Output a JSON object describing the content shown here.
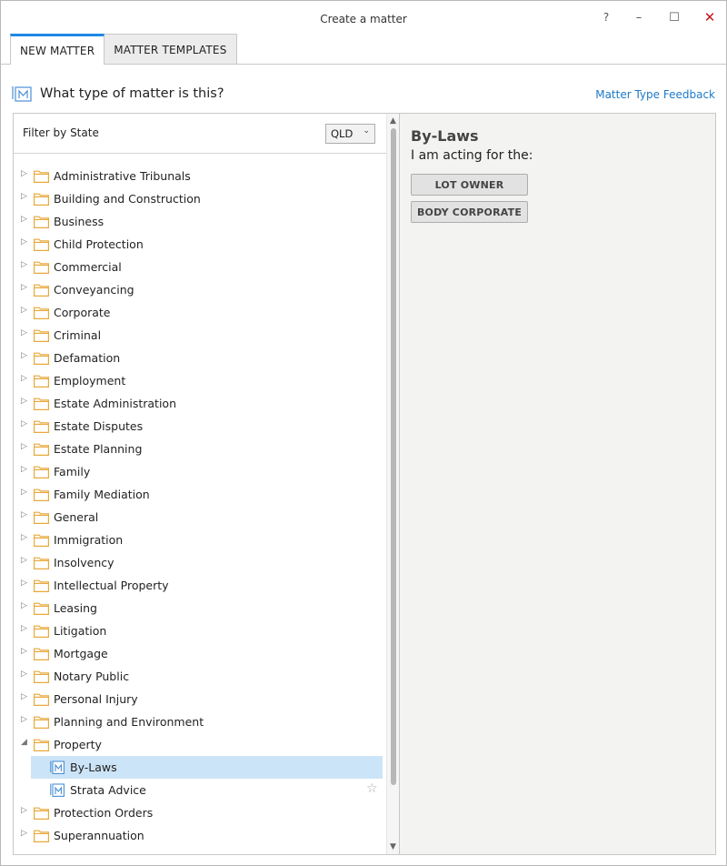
{
  "window": {
    "title": "Create a matter",
    "help_label": "?",
    "min_label": "–",
    "max_label": "☐",
    "close_label": "✕"
  },
  "tabs": [
    {
      "label": "NEW MATTER",
      "active": true
    },
    {
      "label": "MATTER TEMPLATES",
      "active": false
    }
  ],
  "header": {
    "question": "What type of matter is this?",
    "feedback_link": "Matter Type Feedback",
    "icon": "matter-type-icon"
  },
  "filter": {
    "label": "Filter by State",
    "state_value": "QLD",
    "chevron": "⌄"
  },
  "tree": {
    "items": [
      {
        "label": "Administrative Tribunals"
      },
      {
        "label": "Building and Construction"
      },
      {
        "label": "Business"
      },
      {
        "label": "Child Protection"
      },
      {
        "label": "Commercial"
      },
      {
        "label": "Conveyancing"
      },
      {
        "label": "Corporate"
      },
      {
        "label": "Criminal"
      },
      {
        "label": "Defamation"
      },
      {
        "label": "Employment"
      },
      {
        "label": "Estate Administration"
      },
      {
        "label": "Estate Disputes"
      },
      {
        "label": "Estate Planning"
      },
      {
        "label": "Family"
      },
      {
        "label": "Family Mediation"
      },
      {
        "label": "General"
      },
      {
        "label": "Immigration"
      },
      {
        "label": "Insolvency"
      },
      {
        "label": "Intellectual Property"
      },
      {
        "label": "Leasing"
      },
      {
        "label": "Litigation"
      },
      {
        "label": "Mortgage"
      },
      {
        "label": "Notary Public"
      },
      {
        "label": "Personal Injury"
      },
      {
        "label": "Planning and Environment"
      },
      {
        "label": "Property",
        "expanded": true
      },
      {
        "label": "By-Laws",
        "child": true,
        "selected": true
      },
      {
        "label": "Strata Advice",
        "child": true,
        "star": "☆"
      },
      {
        "label": "Protection Orders"
      },
      {
        "label": "Superannuation"
      }
    ]
  },
  "detail": {
    "title": "By-Laws",
    "acting_label": "I am acting for the:",
    "roles": [
      "LOT OWNER",
      "BODY CORPORATE"
    ]
  },
  "colors": {
    "accent": "#1e88e5",
    "link": "#1e7ac7",
    "folder": "#e8a93b",
    "selection": "#cce4f7",
    "close": "#c4161c"
  }
}
